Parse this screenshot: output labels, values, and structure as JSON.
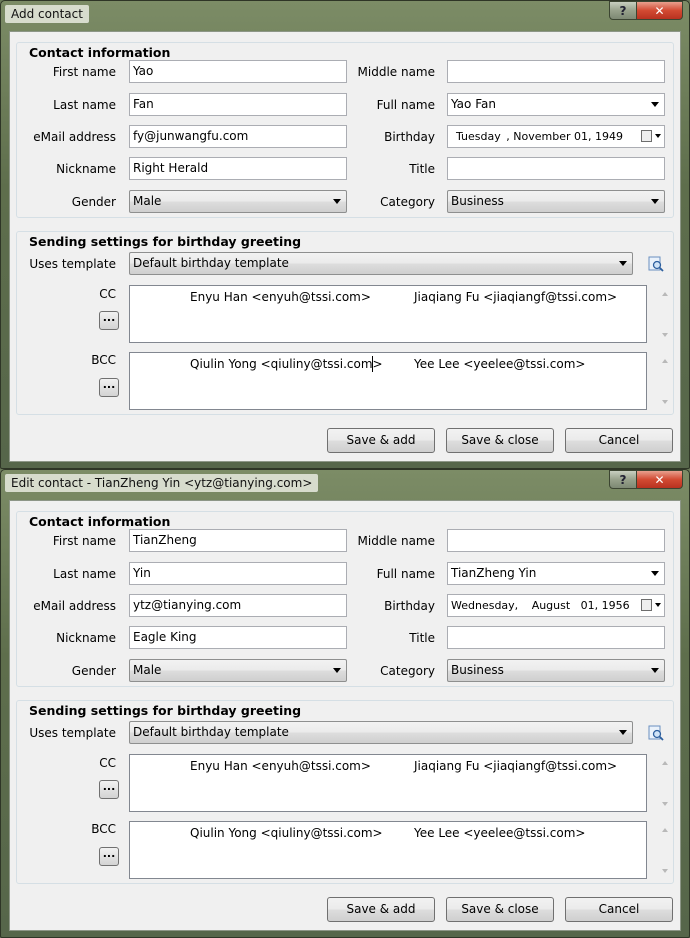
{
  "windows": [
    {
      "title": "Add contact",
      "contact_info": {
        "heading": "Contact information",
        "first_name_label": "First name",
        "first_name": "Yao",
        "middle_name_label": "Middle name",
        "middle_name": "",
        "last_name_label": "Last name",
        "last_name": "Fan",
        "full_name_label": "Full name",
        "full_name": "Yao Fan",
        "email_label": "eMail address",
        "email": "fy@junwangfu.com",
        "birthday_label": "Birthday",
        "birthday_weekday": "Tuesday",
        "birthday_date": ", November 01, 1949",
        "nickname_label": "Nickname",
        "nickname": "Right Herald",
        "title_label": "Title",
        "title": "",
        "gender_label": "Gender",
        "gender": "Male",
        "category_label": "Category",
        "category": "Business"
      },
      "birthday_settings": {
        "heading": "Sending settings for birthday greeting",
        "template_label": "Uses template",
        "template": "Default birthday template",
        "cc_label": "CC",
        "cc": [
          "Enyu Han <enyuh@tssi.com>",
          "Jiaqiang Fu <jiaqiangf@tssi.com>"
        ],
        "bcc_label": "BCC",
        "bcc": [
          "Qiulin Yong <qiuliny@tssi.com>",
          "Yee Lee <yeelee@tssi.com>"
        ],
        "browse_label": "..."
      },
      "buttons": {
        "save_add": "Save & add",
        "save_close": "Save & close",
        "cancel": "Cancel"
      }
    },
    {
      "title": "Edit contact - TianZheng Yin <ytz@tianying.com>",
      "contact_info": {
        "heading": "Contact information",
        "first_name_label": "First name",
        "first_name": "TianZheng",
        "middle_name_label": "Middle name",
        "middle_name": "",
        "last_name_label": "Last name",
        "last_name": "Yin",
        "full_name_label": "Full name",
        "full_name": "TianZheng Yin",
        "email_label": "eMail address",
        "email": "ytz@tianying.com",
        "birthday_label": "Birthday",
        "birthday_weekday": "Wednesday,",
        "birthday_date": "August   01, 1956",
        "nickname_label": "Nickname",
        "nickname": "Eagle King",
        "title_label": "Title",
        "title": "",
        "gender_label": "Gender",
        "gender": "Male",
        "category_label": "Category",
        "category": "Business"
      },
      "birthday_settings": {
        "heading": "Sending settings for birthday greeting",
        "template_label": "Uses template",
        "template": "Default birthday template",
        "cc_label": "CC",
        "cc": [
          "Enyu Han <enyuh@tssi.com>",
          "Jiaqiang Fu <jiaqiangf@tssi.com>"
        ],
        "bcc_label": "BCC",
        "bcc": [
          "Qiulin Yong <qiuliny@tssi.com>",
          "Yee Lee <yeelee@tssi.com>"
        ],
        "browse_label": "..."
      },
      "buttons": {
        "save_add": "Save & add",
        "save_close": "Save & close",
        "cancel": "Cancel"
      }
    }
  ],
  "caption_buttons": {
    "help": "?",
    "close": "✕"
  }
}
